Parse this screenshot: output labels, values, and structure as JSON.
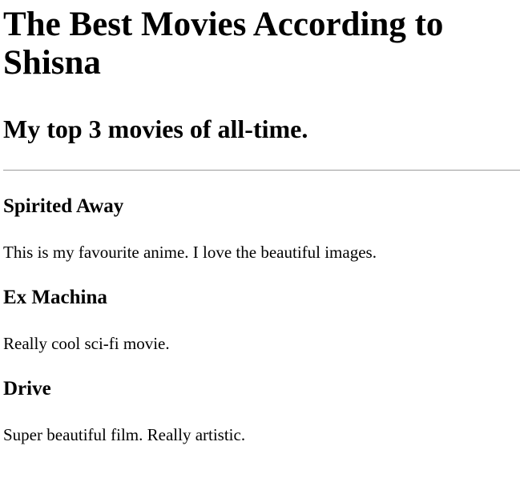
{
  "page": {
    "title": "The Best Movies According to Shisna",
    "subtitle": "My top 3 movies of all-time."
  },
  "movies": [
    {
      "title": "Spirited Away",
      "description": "This is my favourite anime. I love the beautiful images."
    },
    {
      "title": "Ex Machina",
      "description": "Really cool sci-fi movie."
    },
    {
      "title": "Drive",
      "description": "Super beautiful film. Really artistic."
    }
  ]
}
